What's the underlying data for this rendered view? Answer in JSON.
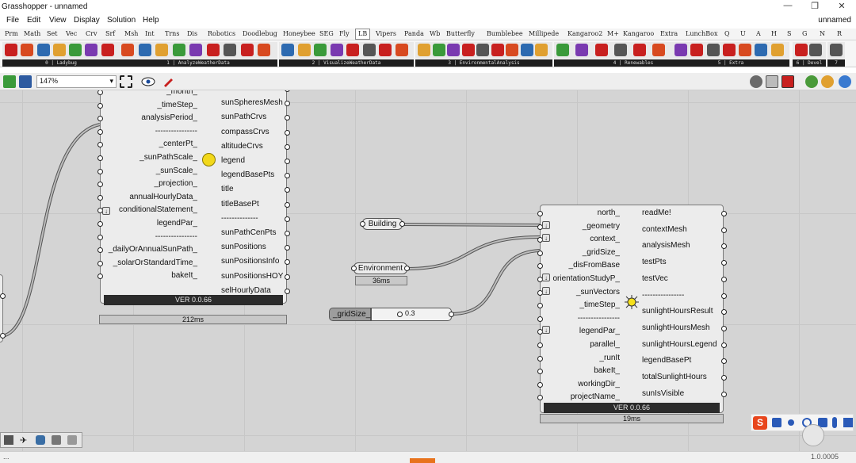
{
  "window": {
    "title": "Grasshopper - unnamed",
    "document_name": "unnamed"
  },
  "menu": [
    "File",
    "Edit",
    "View",
    "Display",
    "Solution",
    "Help"
  ],
  "tabs": [
    "Prm",
    "Math",
    "Set",
    "Vec",
    "Crv",
    "Srf",
    "Msh",
    "Int",
    "Trns",
    "Dis",
    "Robotics",
    "Doodlebug",
    "Honeybee",
    "SEG",
    "Fly",
    "LB",
    "Vipers",
    "Panda",
    "Wb",
    "Butterfly",
    "Bumblebee",
    "Millipede",
    "Kangaroo2",
    "M+",
    "Kangaroo",
    "Extra",
    "LunchBox",
    "Q",
    "U",
    "A",
    "H",
    "S",
    "G",
    "N",
    "R"
  ],
  "active_tab": "LB",
  "ribbon_groups": [
    "0 | Ladybug",
    "1 | AnalyzeWeatherData",
    "2 | VisualizeWeatherData",
    "3 | EnvironmentalAnalysis",
    "4 | Renewables",
    "5 | Extra",
    "6 | Devel",
    "7"
  ],
  "canvas_toolbar": {
    "zoom": "147%"
  },
  "sunpath": {
    "inputs": [
      "_month_",
      "_timeStep_",
      "analysisPeriod_",
      "----------------",
      "_centerPt_",
      "_sunPathScale_",
      "_sunScale_",
      "_projection_",
      "annualHourlyData_",
      "conditionalStatement_",
      "legendPar_",
      "----------------",
      "_dailyOrAnnualSunPath_",
      "_solarOrStandardTime_",
      "bakeIt_"
    ],
    "outputs": [
      "--------------",
      "sunSpheresMesh",
      "sunPathCrvs",
      "compassCrvs",
      "altitudeCrvs",
      "legend",
      "legendBasePts",
      "title",
      "titleBasePt",
      "--------------",
      "sunPathCenPts",
      "sunPositions",
      "sunPositionsInfo",
      "sunPositionsHOY",
      "selHourlyData"
    ],
    "version": "VER 0.0.66",
    "time": "212ms"
  },
  "params": {
    "building": "Building",
    "environment": "Environment",
    "environment_time": "36ms",
    "grid_size_name": "_gridSize_",
    "grid_size_value": "0.3"
  },
  "sunlight": {
    "inputs": [
      "north_",
      "_geometry",
      "context_",
      "_gridSize_",
      "_disFromBase",
      "orientationStudyP_",
      "_sunVectors",
      "_timeStep_",
      "----------------",
      "legendPar_",
      "parallel_",
      "_runIt",
      "bakeIt_",
      "workingDir_",
      "projectName_"
    ],
    "outputs": [
      "readMe!",
      "contextMesh",
      "analysisMesh",
      "testPts",
      "testVec",
      "----------------",
      "sunlightHoursResult",
      "sunlightHoursMesh",
      "sunlightHoursLegend",
      "legendBasePt",
      "totalSunlightHours",
      "sunIsVisible"
    ],
    "version": "VER 0.0.66",
    "time": "19ms"
  },
  "status": {
    "left": "...",
    "right": "1.0.0005"
  },
  "colors": {
    "canvas": "#d4d4d4",
    "component": "#ececec",
    "version_bar": "#2b2b2b",
    "accent_red": "#c8201f"
  }
}
